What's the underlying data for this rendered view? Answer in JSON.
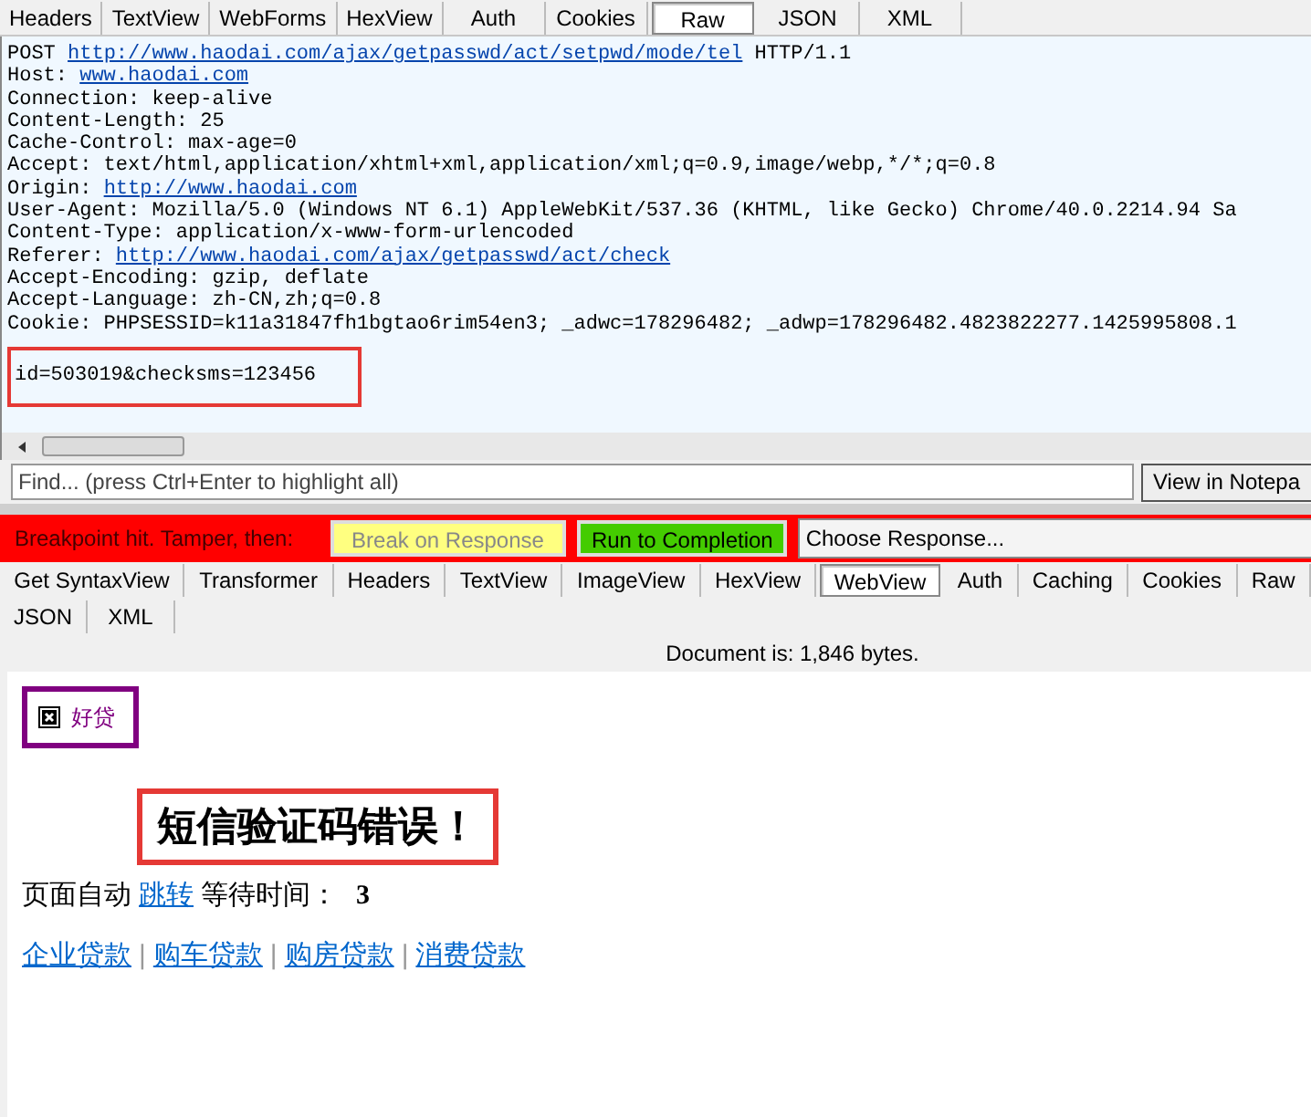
{
  "request_tabs": [
    {
      "label": "Headers",
      "selected": false
    },
    {
      "label": "TextView",
      "selected": false
    },
    {
      "label": "WebForms",
      "selected": false
    },
    {
      "label": "HexView",
      "selected": false
    },
    {
      "label": "Auth",
      "selected": false
    },
    {
      "label": "Cookies",
      "selected": false
    },
    {
      "label": "Raw",
      "selected": true
    },
    {
      "label": "JSON",
      "selected": false
    },
    {
      "label": "XML",
      "selected": false
    }
  ],
  "raw_request": {
    "lines": [
      {
        "prefix": "POST ",
        "link": "http://www.haodai.com/ajax/getpasswd/act/setpwd/mode/tel",
        "suffix": " HTTP/1.1"
      },
      {
        "prefix": "Host: ",
        "link": "www.haodai.com"
      },
      {
        "prefix": "Connection: keep-alive"
      },
      {
        "prefix": "Content-Length: 25"
      },
      {
        "prefix": "Cache-Control: max-age=0"
      },
      {
        "prefix": "Accept: text/html,application/xhtml+xml,application/xml;q=0.9,image/webp,*/*;q=0.8"
      },
      {
        "prefix": "Origin: ",
        "link": "http://www.haodai.com"
      },
      {
        "prefix": "User-Agent: Mozilla/5.0 (Windows NT 6.1) AppleWebKit/537.36 (KHTML, like Gecko) Chrome/40.0.2214.94 Sa"
      },
      {
        "prefix": "Content-Type: application/x-www-form-urlencoded"
      },
      {
        "prefix": "Referer: ",
        "link": "http://www.haodai.com/ajax/getpasswd/act/check"
      },
      {
        "prefix": "Accept-Encoding: gzip, deflate"
      },
      {
        "prefix": "Accept-Language: zh-CN,zh;q=0.8"
      },
      {
        "prefix": "Cookie: PHPSESSID=k11a31847fh1bgtao6rim54en3; _adwc=178296482; _adwp=178296482.4823822277.1425995808.1"
      }
    ],
    "body": "id=503019&checksms=123456"
  },
  "find": {
    "placeholder": "Find... (press Ctrl+Enter to highlight all)",
    "button": "View in Notepa"
  },
  "breakpoint_bar": {
    "message": "Breakpoint hit. Tamper, then:",
    "break_button": "Break on Response",
    "run_button": "Run to Completion",
    "choose_response": "Choose Response..."
  },
  "response_tabs": [
    [
      {
        "label": "Get SyntaxView",
        "selected": false
      },
      {
        "label": "Transformer",
        "selected": false
      },
      {
        "label": "Headers",
        "selected": false
      },
      {
        "label": "TextView",
        "selected": false
      },
      {
        "label": "ImageView",
        "selected": false
      },
      {
        "label": "HexView",
        "selected": false
      },
      {
        "label": "WebView",
        "selected": true
      },
      {
        "label": "Auth",
        "selected": false
      },
      {
        "label": "Caching",
        "selected": false
      },
      {
        "label": "Cookies",
        "selected": false
      },
      {
        "label": "Raw",
        "selected": false
      }
    ],
    [
      {
        "label": "JSON",
        "selected": false
      },
      {
        "label": "XML",
        "selected": false
      }
    ]
  ],
  "document_size": "Document is: 1,846 bytes.",
  "web_view": {
    "logo_alt": "好贷",
    "error_message": "短信验证码错误！",
    "redirect": {
      "prefix": "页面自动",
      "link": "跳转",
      "wait_label": "等待时间：",
      "seconds": "3"
    },
    "links": [
      "企业贷款",
      "购车贷款",
      "购房贷款",
      "消费贷款"
    ],
    "separator": "|"
  }
}
